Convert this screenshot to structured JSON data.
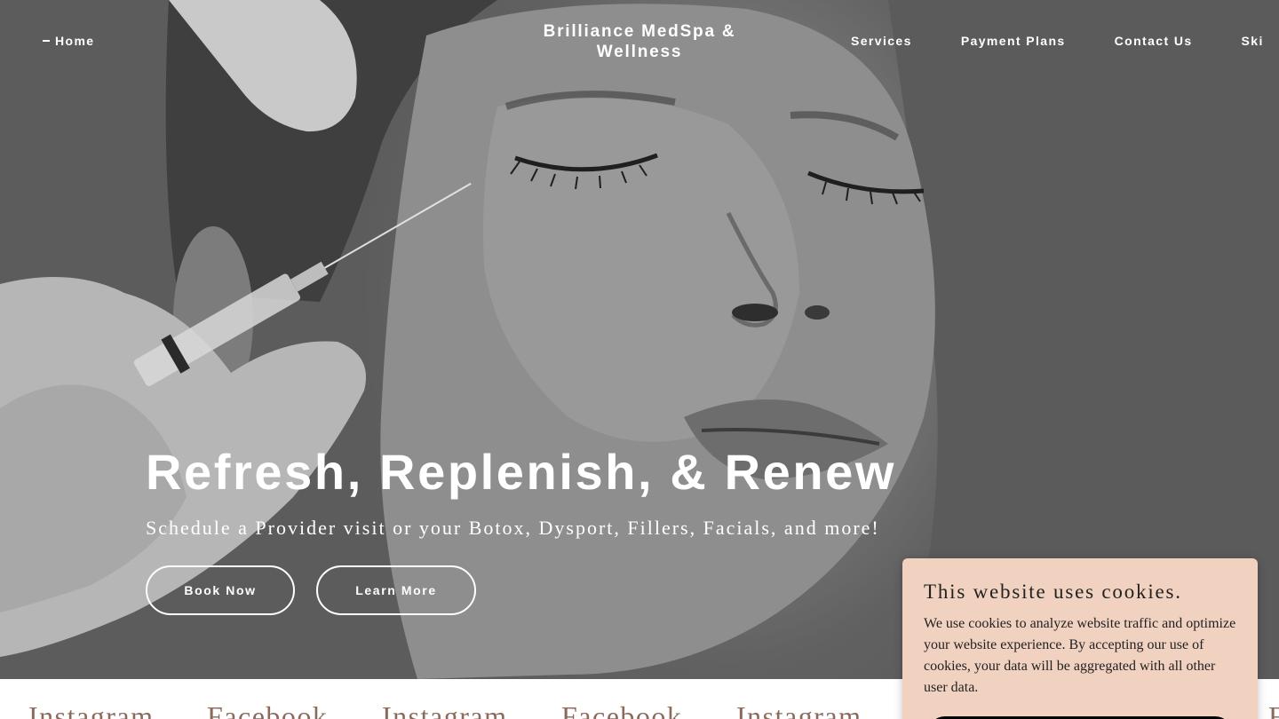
{
  "header": {
    "home_label": "Home",
    "brand_line1": "Brilliance MedSpa &",
    "brand_line2": "Wellness",
    "nav": [
      "Services",
      "Payment Plans",
      "Contact Us",
      "Ski"
    ]
  },
  "hero": {
    "headline": "Refresh, Replenish, & Renew",
    "subline": "Schedule a Provider visit or your Botox, Dysport, Fillers, Facials, and more!",
    "book_label": "Book Now",
    "learn_label": "Learn More"
  },
  "social": [
    "Instagram",
    "Facebook",
    "Instagram",
    "Facebook",
    "Instagram",
    "F"
  ],
  "cookie": {
    "title": "This website uses cookies.",
    "body": "We use cookies to analyze website traffic and optimize your website experience. By accepting our use of cookies, your data will be aggregated with all other user data."
  },
  "colors": {
    "overlay": "#5d5d5d",
    "cookie_bg": "#f1d2c1",
    "social_text": "#8a6a5c"
  }
}
